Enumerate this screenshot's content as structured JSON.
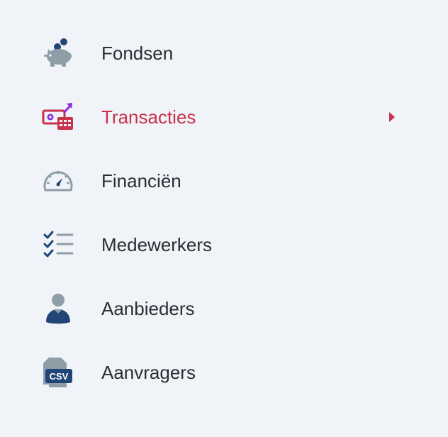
{
  "menu": {
    "items": [
      {
        "label": "Fondsen",
        "icon": "piggy-bank-icon",
        "active": false
      },
      {
        "label": "Transacties",
        "icon": "money-transfer-icon",
        "active": true
      },
      {
        "label": "Financiën",
        "icon": "dashboard-gauge-icon",
        "active": false
      },
      {
        "label": "Medewerkers",
        "icon": "checklist-icon",
        "active": false
      },
      {
        "label": "Aanbieders",
        "icon": "user-icon",
        "active": false
      },
      {
        "label": "Aanvragers",
        "icon": "csv-file-icon",
        "active": false
      }
    ],
    "csv_badge": "CSV"
  },
  "colors": {
    "background": "#f0f3f7",
    "text": "#2a2d33",
    "active": "#c8324a",
    "icon_gray": "#8e9ea6",
    "icon_navy": "#1f4677",
    "icon_purple": "#8a2be2"
  }
}
